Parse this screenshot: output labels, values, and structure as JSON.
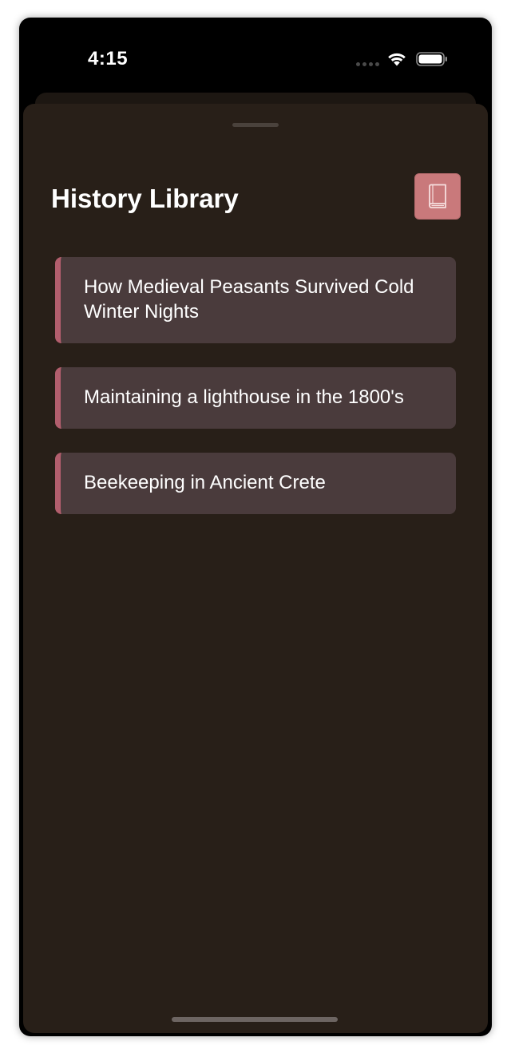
{
  "status_bar": {
    "time": "4:15",
    "icons": [
      "cellular-signal-icon",
      "wifi-icon",
      "battery-icon"
    ]
  },
  "sheet": {
    "title": "History Library",
    "action_icon": "book-icon"
  },
  "books": [
    {
      "title": "How Medieval Peasants Survived Cold Winter Nights"
    },
    {
      "title": "Maintaining a lighthouse in the 1800's"
    },
    {
      "title": "Beekeeping in Ancient Crete"
    }
  ],
  "colors": {
    "sheet_background": "#281f18",
    "card_background": "#4a3b3c",
    "card_accent": "#b25e6d",
    "button_background": "#c9797b",
    "text": "#ffffff"
  }
}
